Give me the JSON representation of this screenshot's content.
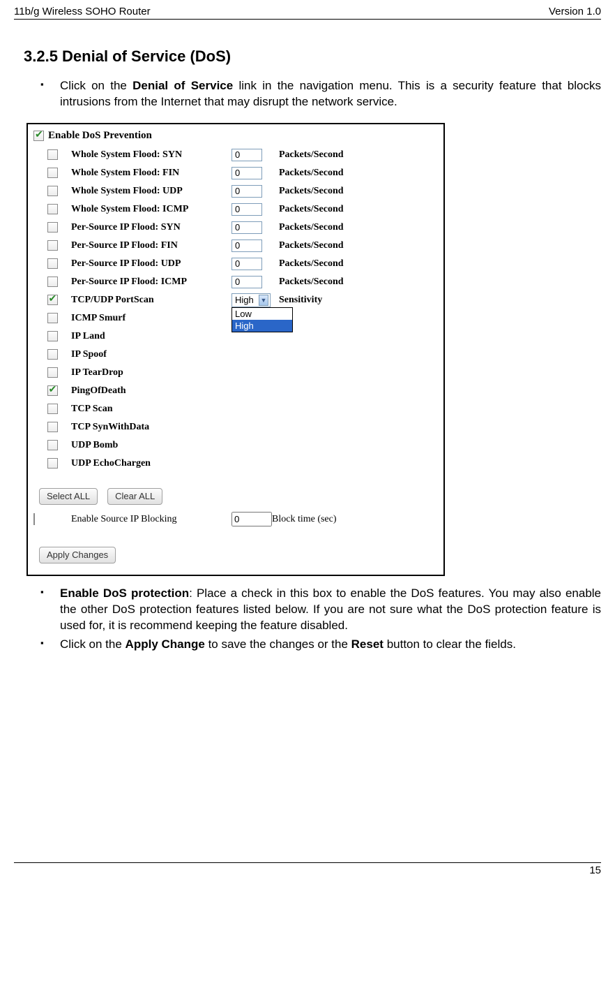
{
  "header": {
    "left": "11b/g Wireless SOHO Router",
    "right": "Version 1.0"
  },
  "title": "3.2.5 Denial of Service (DoS)",
  "intro_pre": "Click on the ",
  "intro_bold": "Denial of Service",
  "intro_post": " link in the navigation menu. This is a security feature that blocks intrusions from the Internet that may disrupt the network service.",
  "panel": {
    "master": {
      "checked": true,
      "label": "Enable DoS Prevention"
    },
    "rows": [
      {
        "checked": false,
        "label": "Whole System Flood: SYN",
        "value": "0",
        "unit": "Packets/Second"
      },
      {
        "checked": false,
        "label": "Whole System Flood: FIN",
        "value": "0",
        "unit": "Packets/Second"
      },
      {
        "checked": false,
        "label": "Whole System Flood: UDP",
        "value": "0",
        "unit": "Packets/Second"
      },
      {
        "checked": false,
        "label": "Whole System Flood: ICMP",
        "value": "0",
        "unit": "Packets/Second"
      },
      {
        "checked": false,
        "label": "Per-Source IP Flood: SYN",
        "value": "0",
        "unit": "Packets/Second"
      },
      {
        "checked": false,
        "label": "Per-Source IP Flood: FIN",
        "value": "0",
        "unit": "Packets/Second"
      },
      {
        "checked": false,
        "label": "Per-Source IP Flood: UDP",
        "value": "0",
        "unit": "Packets/Second"
      },
      {
        "checked": false,
        "label": "Per-Source IP Flood: ICMP",
        "value": "0",
        "unit": "Packets/Second"
      }
    ],
    "portscan": {
      "checked": true,
      "label": "TCP/UDP PortScan",
      "selected": "High",
      "options": [
        "Low",
        "High"
      ],
      "unit": "Sensitivity"
    },
    "toggles": [
      {
        "checked": false,
        "label": "ICMP Smurf"
      },
      {
        "checked": false,
        "label": "IP Land"
      },
      {
        "checked": false,
        "label": "IP Spoof"
      },
      {
        "checked": false,
        "label": "IP TearDrop"
      },
      {
        "checked": true,
        "label": "PingOfDeath"
      },
      {
        "checked": false,
        "label": "TCP Scan"
      },
      {
        "checked": false,
        "label": "TCP SynWithData"
      },
      {
        "checked": false,
        "label": "UDP Bomb"
      },
      {
        "checked": false,
        "label": "UDP EchoChargen"
      }
    ],
    "buttons": {
      "select_all": "Select ALL",
      "clear_all": "Clear ALL"
    },
    "source_block": {
      "checked": false,
      "label": "Enable Source IP Blocking",
      "value": "0",
      "unit": "Block time (sec)"
    },
    "apply": "Apply Changes"
  },
  "after": [
    {
      "bold": "Enable DoS protection",
      "text": ": Place a check in this box to enable the DoS features. You may also enable the other DoS protection features listed below. If you are not sure what the DoS protection feature is used for, it is recommend keeping the feature disabled."
    },
    {
      "pre": "Click on the ",
      "b1": "Apply Change",
      "mid": " to save the changes or the ",
      "b2": "Reset",
      "post": " button to clear the fields."
    }
  ],
  "page_num": "15"
}
